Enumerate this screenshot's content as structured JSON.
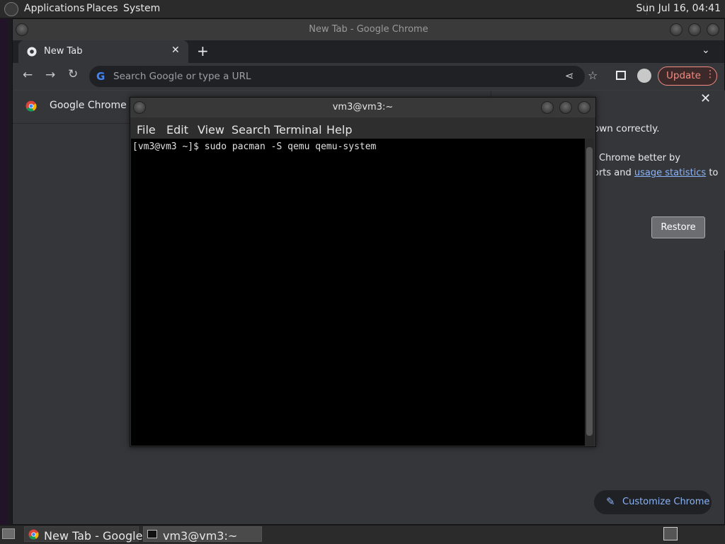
{
  "top_panel": {
    "applications": "Applications",
    "places": "Places",
    "system": "System",
    "clock": "Sun Jul 16, 04:41"
  },
  "chrome": {
    "window_title": "New Tab - Google Chrome",
    "tab_title": "New Tab",
    "tab_close": "✕",
    "new_tab": "+",
    "tab_search": "⌄",
    "omnibox_placeholder": "Search Google or type a URL",
    "google_logo": "G",
    "update_label": "Update",
    "update_menu": "⋮",
    "infobar_text": "Google Chrome isn't your default browser",
    "dialog": {
      "close": "✕",
      "line1": "own correctly.",
      "line2": "Chrome better by",
      "line3_prefix": "orts and ",
      "line3_link": "usage statistics",
      "line3_suffix": " to",
      "restore_label": "Restore"
    },
    "customize_label": "Customize Chrome",
    "customize_icon": "✎"
  },
  "terminal": {
    "title": "vm3@vm3:~",
    "menu": [
      "File",
      "Edit",
      "View",
      "Search",
      "Terminal",
      "Help"
    ],
    "line": "[vm3@vm3 ~]$ sudo pacman -S qemu qemu-system"
  },
  "taskbar": {
    "task1": "New Tab - Google ...",
    "task2": "vm3@vm3:~"
  }
}
